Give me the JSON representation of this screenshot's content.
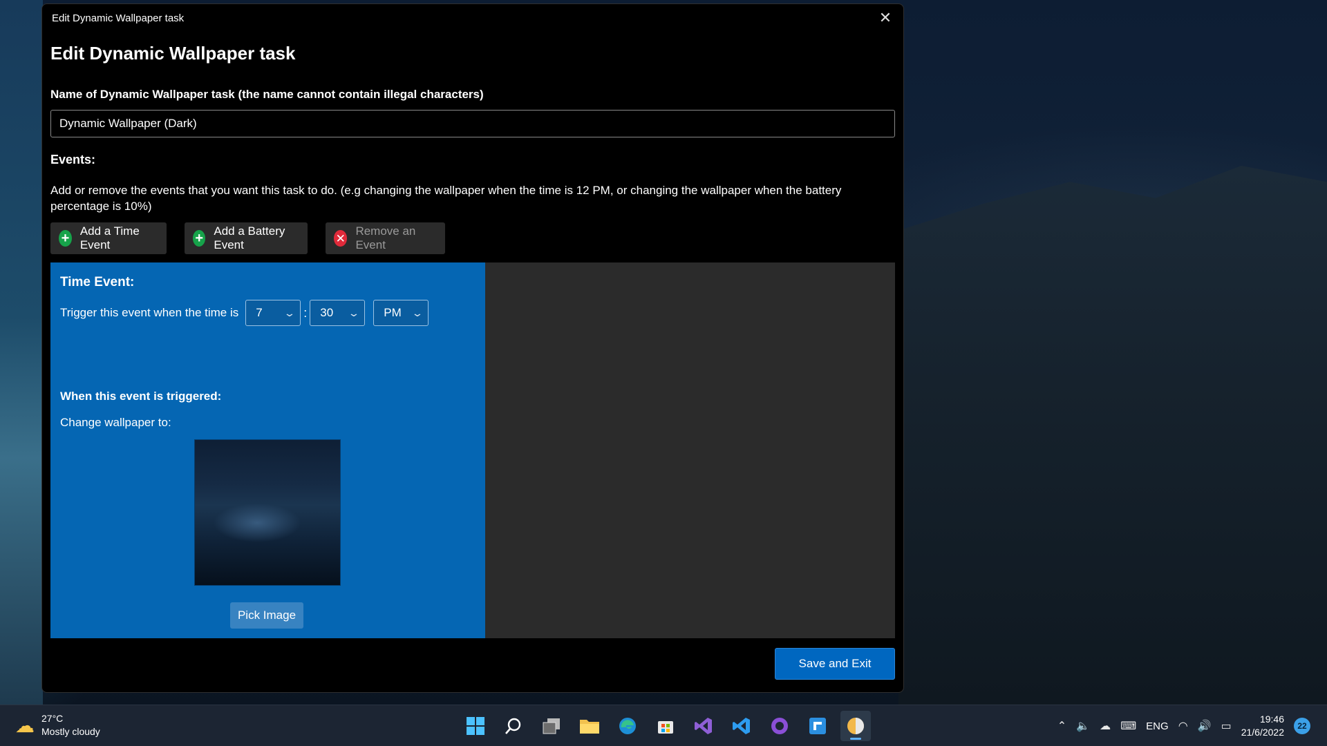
{
  "window": {
    "title": "Edit Dynamic Wallpaper task",
    "close_glyph": "✕"
  },
  "page": {
    "title": "Edit Dynamic Wallpaper task",
    "name_label": "Name of Dynamic Wallpaper task (the name cannot contain illegal characters)",
    "name_value": "Dynamic Wallpaper (Dark)",
    "events_label": "Events:",
    "events_description": "Add or remove the events that you want this task to do. (e.g changing the wallpaper when the time is 12 PM, or changing the wallpaper when the battery percentage is 10%)"
  },
  "buttons": {
    "add_time": "Add a Time Event",
    "add_battery": "Add a Battery Event",
    "remove": "Remove an Event",
    "pick_image": "Pick Image",
    "save_exit": "Save and Exit"
  },
  "event": {
    "title": "Time Event:",
    "trigger_text": "Trigger this event when the time is",
    "hour": "7",
    "minute": "30",
    "separator": ":",
    "period": "PM",
    "triggered_label": "When this event is triggered:",
    "change_label": "Change wallpaper to:"
  },
  "taskbar": {
    "weather_temp": "27°C",
    "weather_desc": "Mostly cloudy",
    "language": "ENG",
    "time": "19:46",
    "date": "21/6/2022",
    "notification_count": "22",
    "apps": [
      "start",
      "search",
      "task-view",
      "file-explorer",
      "edge",
      "store",
      "visual-studio",
      "vscode",
      "github-desktop",
      "notepad",
      "dynamic-wallpaper"
    ]
  },
  "colors": {
    "accent": "#0067c0",
    "event_panel": "#0566b3",
    "window_bg": "#000000",
    "button_bg": "#2b2b2b"
  }
}
